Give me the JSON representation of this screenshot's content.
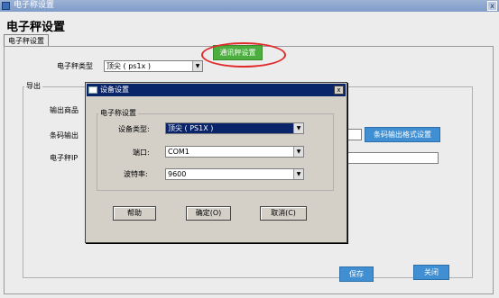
{
  "window": {
    "title": "电子称设置",
    "heading": "电子秤设置",
    "tab_label": "电子秤设置"
  },
  "main": {
    "scale_type_label": "电子秤类型",
    "scale_type_value": "顶尖 ( ps1x )",
    "comm_button": "通讯秤设置",
    "export_group_title": "导出",
    "output_product_label": "输出商品",
    "barcode_output_label": "条码输出",
    "scale_ip_label": "电子秤IP",
    "barcode_format_button": "条码输出格式设置",
    "save_button": "保存",
    "close_button": "关闭"
  },
  "dialog": {
    "title": "设备设置",
    "group_title": "电子称设置",
    "device_type_label": "设备类型:",
    "device_type_value": "顶尖 ( PS1X )",
    "port_label": "端口:",
    "port_value": "COM1",
    "baud_label": "波特率:",
    "baud_value": "9600",
    "help_button": "帮助",
    "ok_button": "确定(O)",
    "cancel_button": "取消(C)",
    "close_glyph": "x"
  },
  "colors": {
    "accent_green": "#4cae3f",
    "accent_blue": "#3f8fd2",
    "highlight_ring": "#e02a2a",
    "dialog_title": "#0a246a"
  },
  "icons": [
    "app-icon",
    "close-icon",
    "dropdown-arrow-icon",
    "dialog-icon"
  ]
}
